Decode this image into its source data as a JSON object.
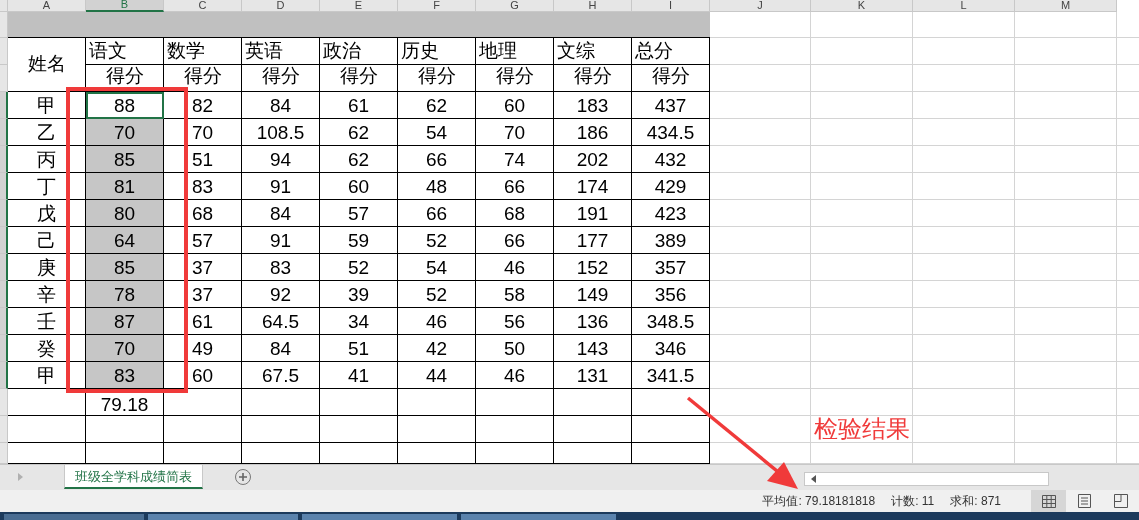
{
  "column_headers": [
    {
      "label": "A",
      "selected": false
    },
    {
      "label": "B",
      "selected": true
    },
    {
      "label": "C",
      "selected": false
    },
    {
      "label": "D",
      "selected": false
    },
    {
      "label": "E",
      "selected": false
    },
    {
      "label": "F",
      "selected": false
    },
    {
      "label": "G",
      "selected": false
    },
    {
      "label": "H",
      "selected": false
    },
    {
      "label": "I",
      "selected": false
    },
    {
      "label": "J",
      "selected": false
    },
    {
      "label": "K",
      "selected": false
    },
    {
      "label": "L",
      "selected": false
    },
    {
      "label": "M",
      "selected": false
    }
  ],
  "table": {
    "name_header": "姓名",
    "subjects": [
      {
        "name": "语文",
        "sub": "得分"
      },
      {
        "name": "数学",
        "sub": "得分"
      },
      {
        "name": "英语",
        "sub": "得分"
      },
      {
        "name": "政治",
        "sub": "得分"
      },
      {
        "name": "历史",
        "sub": "得分"
      },
      {
        "name": "地理",
        "sub": "得分"
      },
      {
        "name": "文综",
        "sub": "得分"
      },
      {
        "name": "总分",
        "sub": "得分"
      }
    ],
    "rows": [
      {
        "name": "甲",
        "scores": [
          "88",
          "82",
          "84",
          "61",
          "62",
          "60",
          "183",
          "437"
        ],
        "selected": true,
        "active": true
      },
      {
        "name": "乙",
        "scores": [
          "70",
          "70",
          "108.5",
          "62",
          "54",
          "70",
          "186",
          "434.5"
        ],
        "selected": true,
        "active": false
      },
      {
        "name": "丙",
        "scores": [
          "85",
          "51",
          "94",
          "62",
          "66",
          "74",
          "202",
          "432"
        ],
        "selected": true,
        "active": false
      },
      {
        "name": "丁",
        "scores": [
          "81",
          "83",
          "91",
          "60",
          "48",
          "66",
          "174",
          "429"
        ],
        "selected": true,
        "active": false
      },
      {
        "name": "戊",
        "scores": [
          "80",
          "68",
          "84",
          "57",
          "66",
          "68",
          "191",
          "423"
        ],
        "selected": true,
        "active": false
      },
      {
        "name": "己",
        "scores": [
          "64",
          "57",
          "91",
          "59",
          "52",
          "66",
          "177",
          "389"
        ],
        "selected": true,
        "active": false
      },
      {
        "name": "庚",
        "scores": [
          "85",
          "37",
          "83",
          "52",
          "54",
          "46",
          "152",
          "357"
        ],
        "selected": true,
        "active": false
      },
      {
        "name": "辛",
        "scores": [
          "78",
          "37",
          "92",
          "39",
          "52",
          "58",
          "149",
          "356"
        ],
        "selected": true,
        "active": false
      },
      {
        "name": "壬",
        "scores": [
          "87",
          "61",
          "64.5",
          "34",
          "46",
          "56",
          "136",
          "348.5"
        ],
        "selected": true,
        "active": false
      },
      {
        "name": "癸",
        "scores": [
          "70",
          "49",
          "84",
          "51",
          "42",
          "50",
          "143",
          "346"
        ],
        "selected": true,
        "active": false
      },
      {
        "name": "甲",
        "scores": [
          "83",
          "60",
          "67.5",
          "41",
          "44",
          "46",
          "131",
          "341.5"
        ],
        "selected": true,
        "active": false
      }
    ],
    "average": "79.18"
  },
  "sheet_tabs": [
    {
      "label": "班级全学科成绩简表",
      "selected": true
    }
  ],
  "status_bar": {
    "average": "平均值: 79.18181818",
    "count": "计数: 11",
    "sum": "求和: 871",
    "views": [
      {
        "kind": "normal",
        "selected": true
      },
      {
        "kind": "page-layout",
        "selected": false
      },
      {
        "kind": "page-break",
        "selected": false
      }
    ]
  },
  "annotation": {
    "label": "检验结果"
  }
}
